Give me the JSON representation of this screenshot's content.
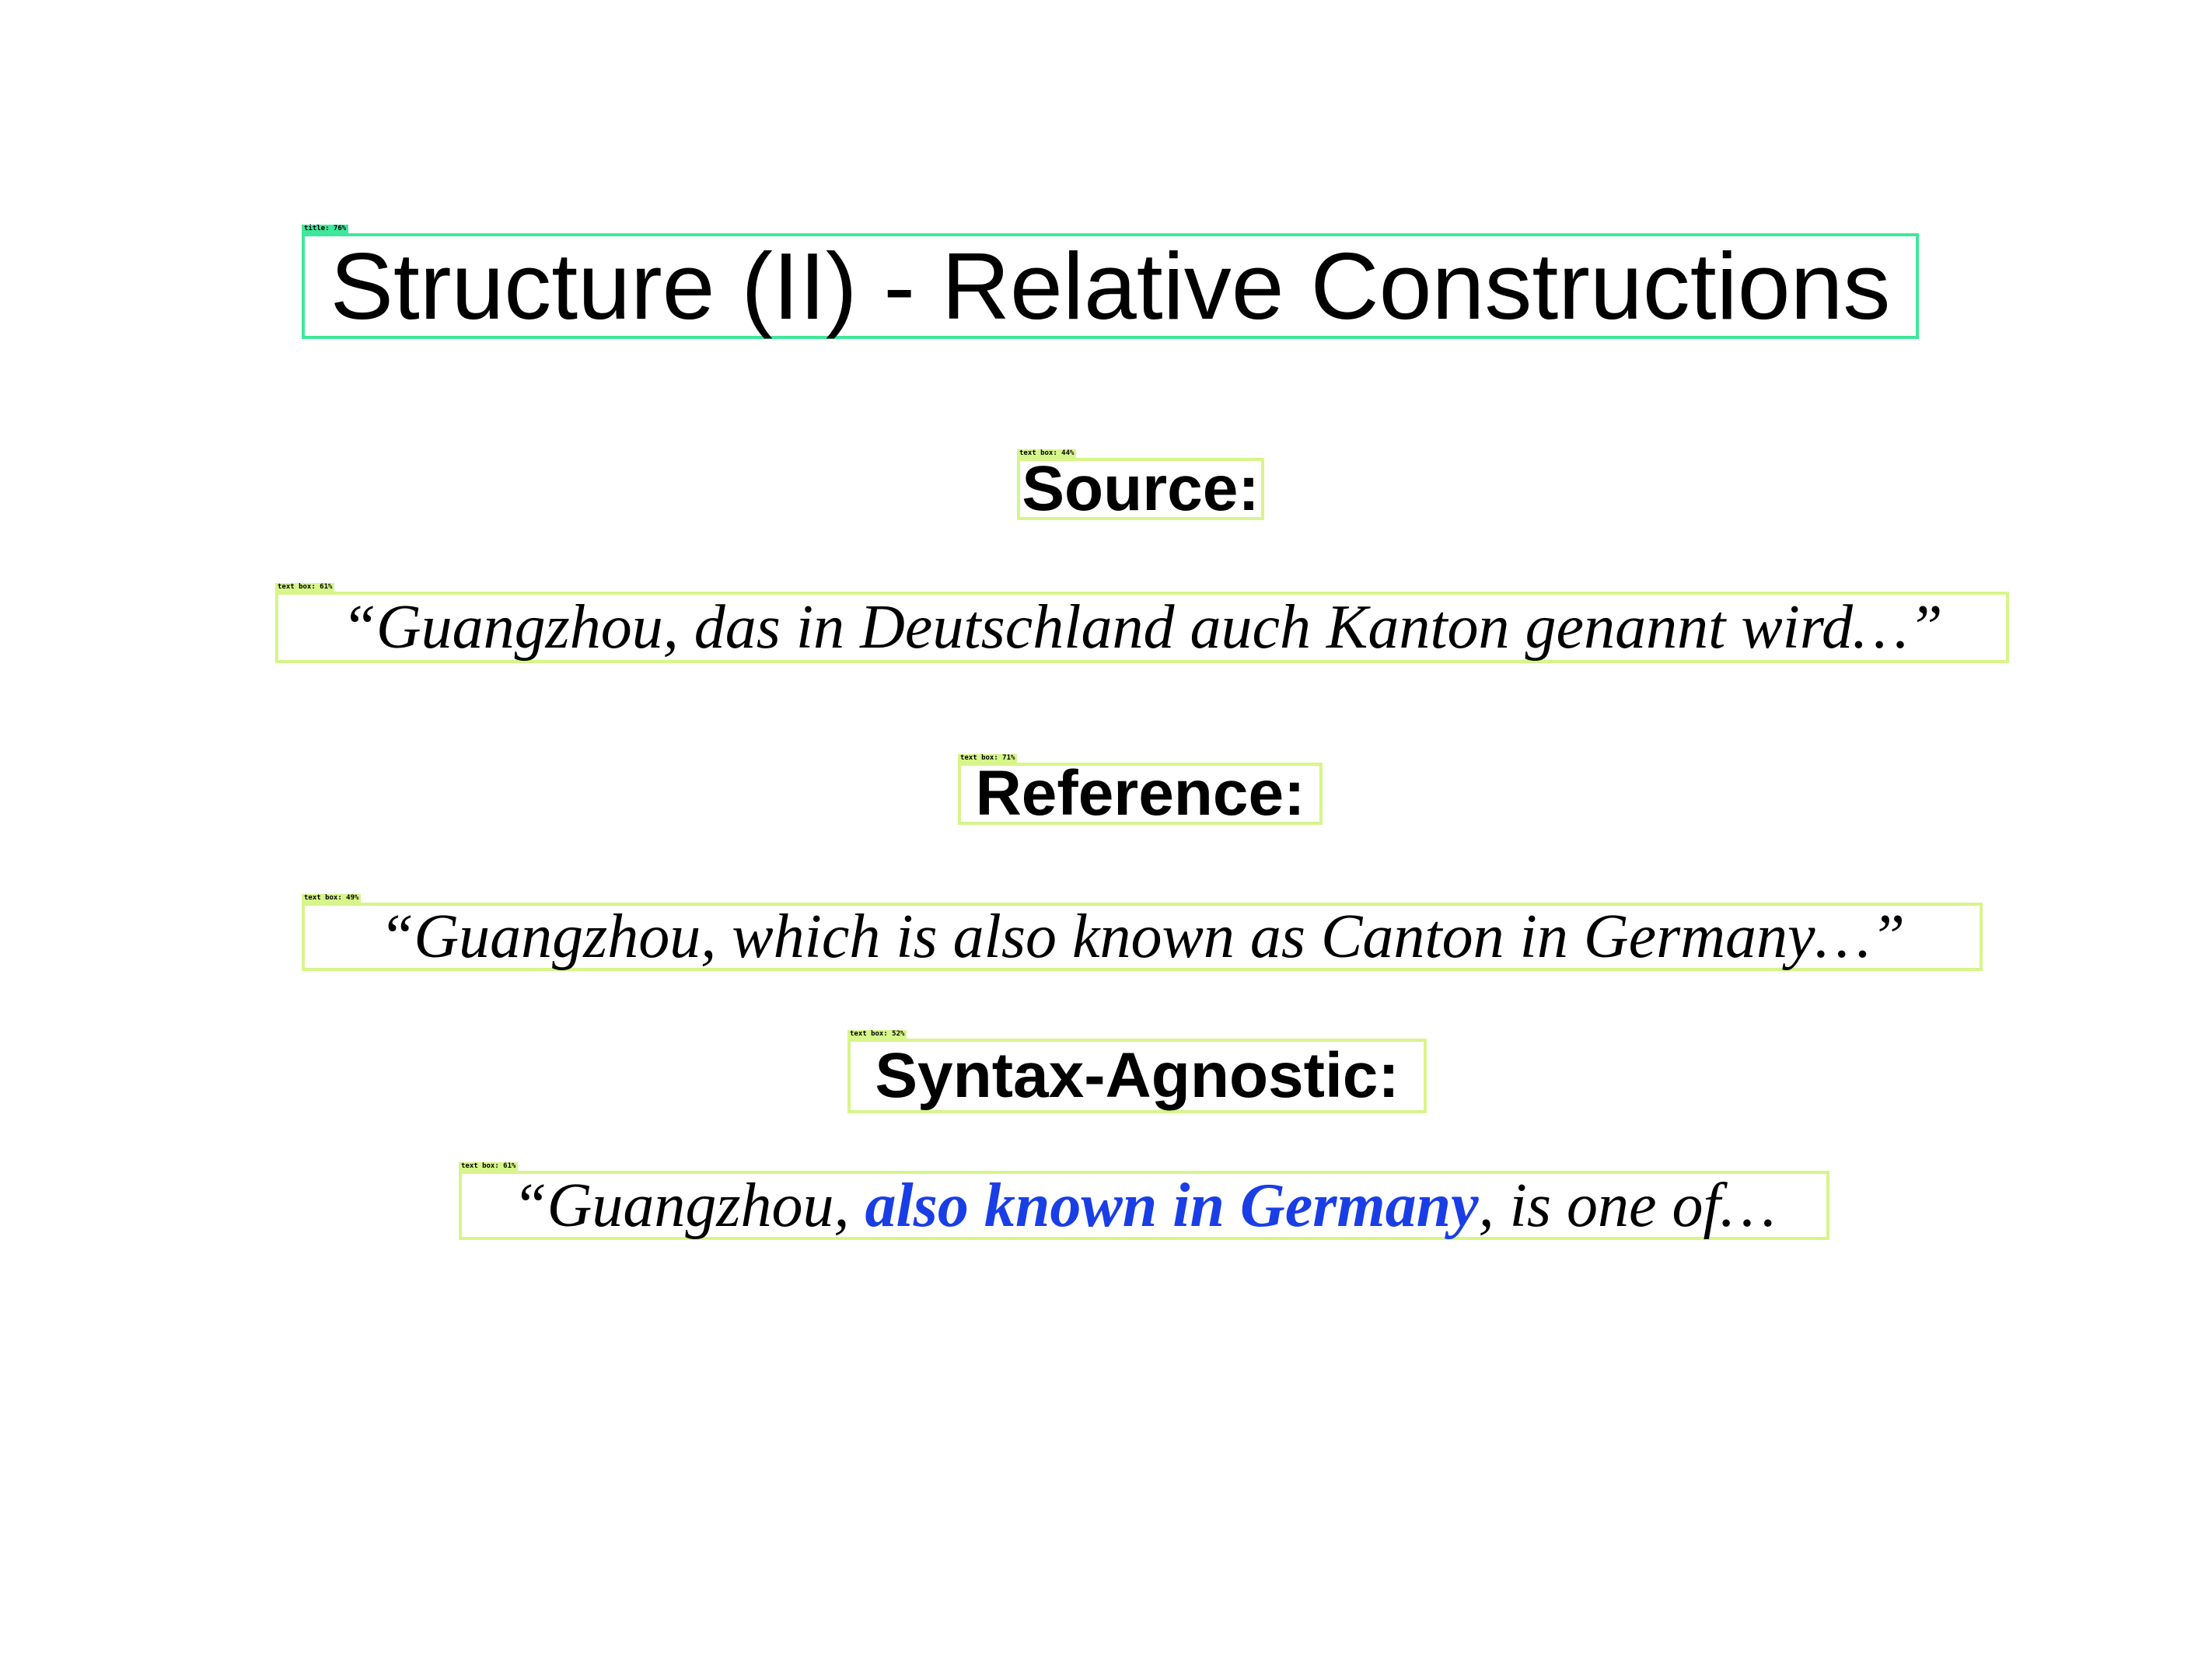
{
  "title": {
    "tag": "title: 76%",
    "text": "Structure (II) - Relative Constructions"
  },
  "sections": [
    {
      "heading_tag": "text box: 44%",
      "heading": "Source:",
      "quote_tag": "text box: 61%",
      "quote": "“Guangzhou, das in Deutschland auch Kanton genannt wird…”"
    },
    {
      "heading_tag": "text box: 71%",
      "heading": "Reference:",
      "quote_tag": "text box: 49%",
      "quote": "“Guangzhou, which is also known as Canton in Germany…”"
    },
    {
      "heading_tag": "text box: 52%",
      "heading": "Syntax-Agnostic:",
      "quote_tag": "text box: 61%",
      "quote_parts": {
        "before": "“Guangzhou, ",
        "highlight": "also known in Germany",
        "after": ", is one of…"
      }
    }
  ],
  "colors": {
    "title_box_border": "#3ee89a",
    "text_box_border": "#d6f58a",
    "highlight": "#1a3ee6"
  }
}
